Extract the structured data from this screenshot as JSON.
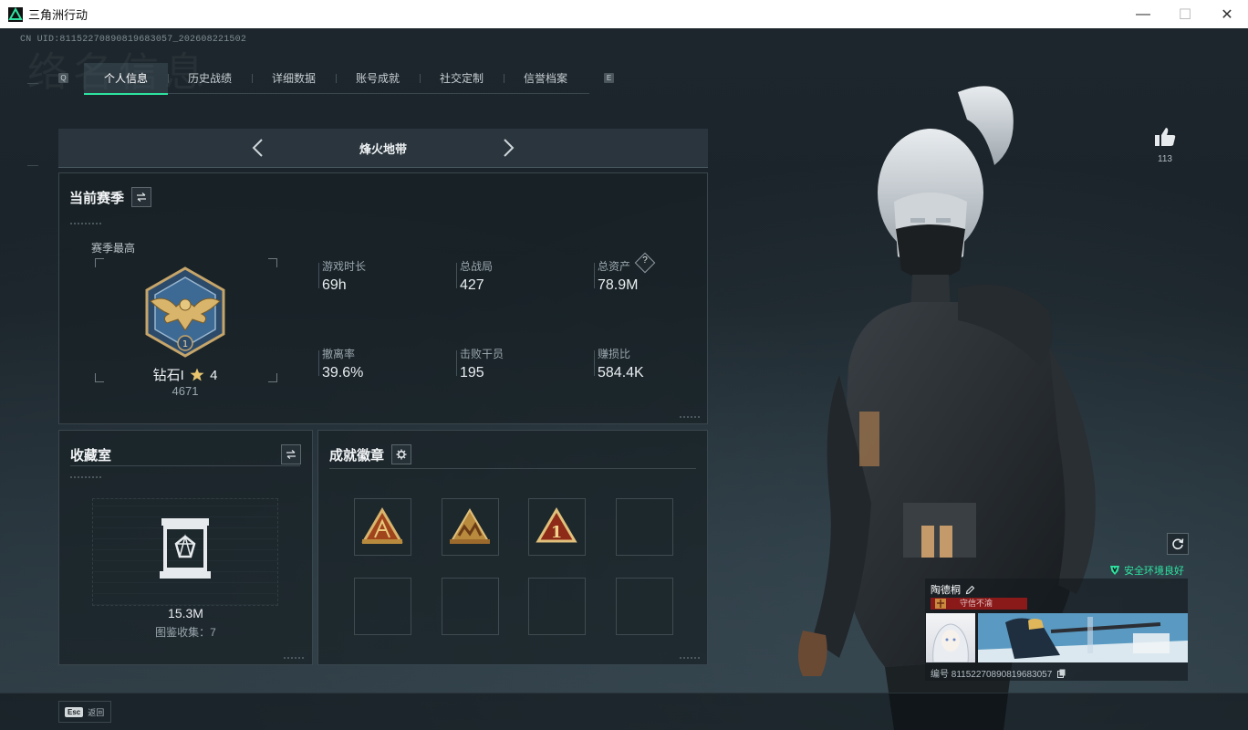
{
  "window": {
    "title": "三角洲行动",
    "minimize": "—",
    "maximize": "☐",
    "close": "✕"
  },
  "uid_text": "CN UID:8115227089081968​3057_202608221502",
  "watermark": "络名信息",
  "tabs": [
    {
      "label": "个人信息",
      "active": true
    },
    {
      "label": "历史战绩",
      "active": false
    },
    {
      "label": "详细数据",
      "active": false
    },
    {
      "label": "账号成就",
      "active": false
    },
    {
      "label": "社交定制",
      "active": false
    },
    {
      "label": "信誉档案",
      "active": false
    }
  ],
  "tab_keys": {
    "left": "Q",
    "right": "E"
  },
  "mode": {
    "label": "烽火地带"
  },
  "season": {
    "title": "当前赛季",
    "best_label": "赛季最高",
    "rank_name": "钻石I",
    "rank_stars": "4",
    "rank_score": "4671",
    "stats": [
      {
        "label": "游戏时长",
        "value": "69h"
      },
      {
        "label": "总战局",
        "value": "427"
      },
      {
        "label": "总资产",
        "value": "78.9M"
      },
      {
        "label": "撤离率",
        "value": "39.6%"
      },
      {
        "label": "击败干员",
        "value": "195"
      },
      {
        "label": "赚损比",
        "value": "584.4K"
      }
    ],
    "help_icon": "?"
  },
  "collection": {
    "title": "收藏室",
    "value": "15.3M",
    "count_text": "图鉴收集：7"
  },
  "achievements": {
    "title": "成就徽章"
  },
  "likes": {
    "count": "113"
  },
  "safety": {
    "text": "安全环境良好",
    "color": "#2ee3a0"
  },
  "player_card": {
    "name": "陶德桐",
    "rank_text": "守信不渝",
    "id_text": "编号 8115227089081968​3057"
  },
  "footer": {
    "esc_key": "Esc",
    "back_label": "返回"
  },
  "colors": {
    "accent": "#2ee3a0",
    "rank_bar": "#8a1a1a"
  }
}
